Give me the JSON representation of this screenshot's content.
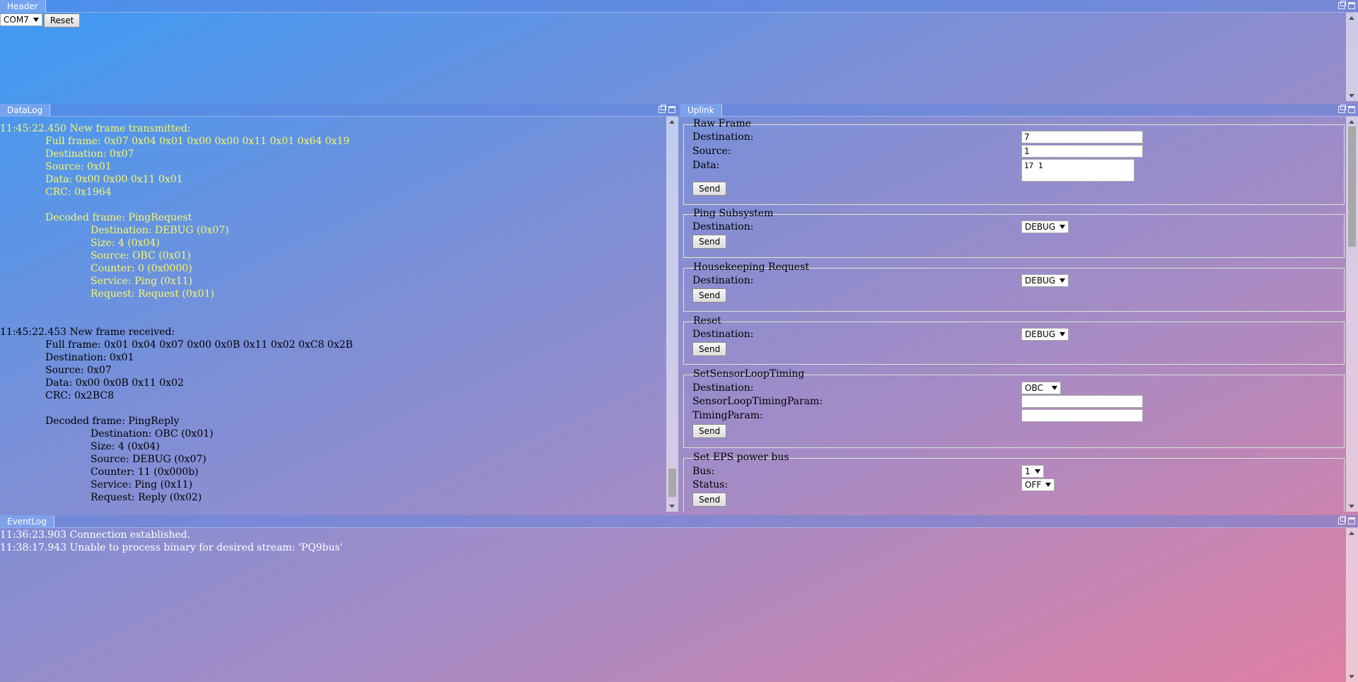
{
  "header": {
    "tab": "Header",
    "port_selected": "COM7",
    "reset_label": "Reset"
  },
  "datalog": {
    "tab": "DataLog",
    "tx": {
      "heading": "11:45:22.450 New frame transmitted:",
      "full_frame": "Full frame: 0x07 0x04 0x01 0x00 0x00 0x11 0x01 0x64 0x19",
      "destination": "Destination: 0x07",
      "source": "Source: 0x01",
      "data": "Data: 0x00 0x00 0x11 0x01",
      "crc": "CRC: 0x1964",
      "decoded": "Decoded frame: PingRequest",
      "d_destination": "Destination: DEBUG (0x07)",
      "d_size": "Size: 4 (0x04)",
      "d_source": "Source: OBC (0x01)",
      "d_counter": "Counter: 0 (0x0000)",
      "d_service": "Service: Ping (0x11)",
      "d_request": "Request: Request (0x01)"
    },
    "rx": {
      "heading": "11:45:22.453 New frame received:",
      "full_frame": "Full frame: 0x01 0x04 0x07 0x00 0x0B 0x11 0x02 0xC8 0x2B",
      "destination": "Destination: 0x01",
      "source": "Source: 0x07",
      "data": "Data: 0x00 0x0B 0x11 0x02",
      "crc": "CRC: 0x2BC8",
      "decoded": "Decoded frame: PingReply",
      "d_destination": "Destination: OBC (0x01)",
      "d_size": "Size: 4 (0x04)",
      "d_source": "Source: DEBUG (0x07)",
      "d_counter": "Counter: 11 (0x000b)",
      "d_service": "Service: Ping (0x11)",
      "d_request": "Request: Reply (0x02)"
    }
  },
  "uplink": {
    "tab": "Uplink",
    "send_label": "Send",
    "raw_frame": {
      "legend": "Raw Frame",
      "destination_label": "Destination:",
      "destination_value": "7",
      "source_label": "Source:",
      "source_value": "1",
      "data_label": "Data:",
      "data_value": "17 1"
    },
    "ping": {
      "legend": "Ping Subsystem",
      "destination_label": "Destination:",
      "destination_value": "DEBUG"
    },
    "housekeeping": {
      "legend": "Housekeeping Request",
      "destination_label": "Destination:",
      "destination_value": "DEBUG"
    },
    "reset": {
      "legend": "Reset",
      "destination_label": "Destination:",
      "destination_value": "DEBUG"
    },
    "sensor_loop": {
      "legend": "SetSensorLoopTiming",
      "destination_label": "Destination:",
      "destination_value": "OBC",
      "sensor_param_label": "SensorLoopTimingParam:",
      "sensor_param_value": "",
      "timing_param_label": "TimingParam:",
      "timing_param_value": ""
    },
    "eps": {
      "legend": "Set EPS power bus",
      "bus_label": "Bus:",
      "bus_value": "1",
      "status_label": "Status:",
      "status_value": "OFF"
    }
  },
  "eventlog": {
    "tab": "EventLog",
    "entries": [
      "11:36:23.903 Connection established.",
      "11:38:17.943 Unable to process binary for desired stream: 'PQ9bus'"
    ]
  }
}
